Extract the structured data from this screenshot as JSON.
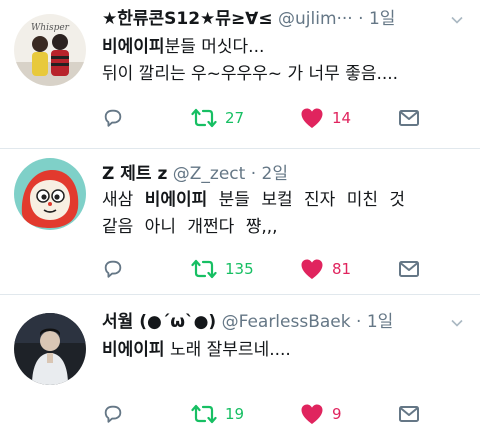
{
  "colors": {
    "retweet": "#17bf63",
    "like": "#e0245e",
    "icon_gray": "#657786"
  },
  "tweets": [
    {
      "avatar_icon": "profile-photo-two-people-whisper",
      "avatar_text": "Whisper",
      "name": "★한류콘S12★뮤≥∀≤",
      "handle": "@ujlim···",
      "sep": "·",
      "time": "1일",
      "text_lines": [
        {
          "bold": "비에이피",
          "rest": "분들 머싯다..."
        },
        {
          "bold": "",
          "rest": "뒤이 깔리는 우~우우우~ 가 너무 좋음...."
        }
      ],
      "retweets": "27",
      "likes": "14",
      "liked": true
    },
    {
      "avatar_icon": "cartoon-character-avatar",
      "avatar_text": "",
      "name": "Z 제트 z",
      "handle": "@Z_zect",
      "sep": "·",
      "time": "2일",
      "text_lines": [
        {
          "pre": "새삼 ",
          "bold": "비에이피",
          "rest": " 분들 보컬 진자 미친 것"
        },
        {
          "pre": "",
          "bold": "",
          "rest": "같음 아니 개쩐다 쨩,,,"
        }
      ],
      "retweets": "135",
      "likes": "81",
      "liked": true
    },
    {
      "avatar_icon": "profile-photo-person",
      "avatar_text": "",
      "name": "서월 (●´ω`●)",
      "handle": "@FearlessBaek",
      "sep": "·",
      "time": "1일",
      "text_lines": [
        {
          "pre": "",
          "bold": "비에이피",
          "rest": " 노래 잘부르네...."
        }
      ],
      "retweets": "19",
      "likes": "9",
      "liked": true
    }
  ]
}
